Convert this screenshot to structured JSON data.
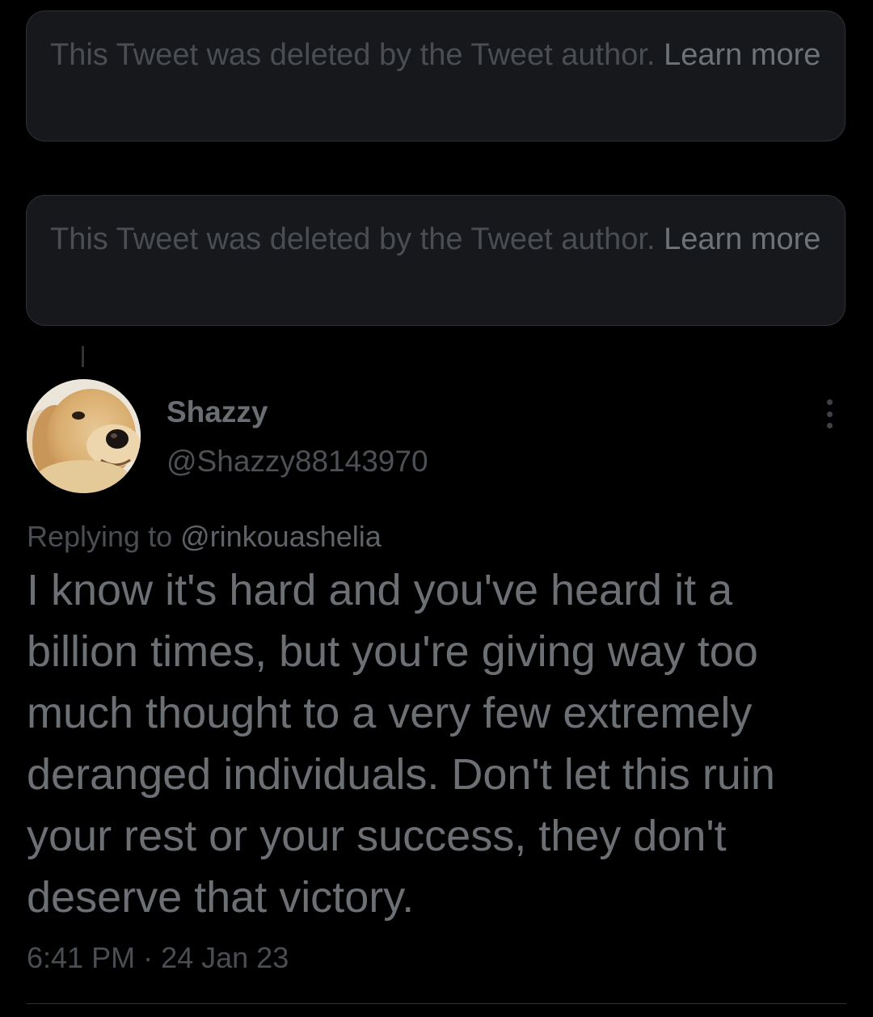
{
  "deleted_notices": [
    {
      "text": "This Tweet was deleted by the Tweet author. ",
      "link_label": "Learn more"
    },
    {
      "text": "This Tweet was deleted by the Tweet author. ",
      "link_label": "Learn more"
    }
  ],
  "tweet": {
    "author": {
      "display_name": "Shazzy",
      "handle": "@Shazzy88143970",
      "avatar_icon": "golden-retriever-avatar"
    },
    "replying_prefix": "Replying to ",
    "replying_to": "@rinkouashelia",
    "text": "I know it's hard and you've heard it a billion times, but you're giving way too much thought to a very few extremely deranged individuals. Don't let this ruin your rest or your success, they don't deserve that victory.",
    "time": "6:41 PM",
    "separator": " · ",
    "date": "24 Jan 23"
  },
  "icons": {
    "more": "more-options-icon"
  },
  "colors": {
    "background": "#000000",
    "card": "#16181c",
    "border": "#2f3336"
  }
}
